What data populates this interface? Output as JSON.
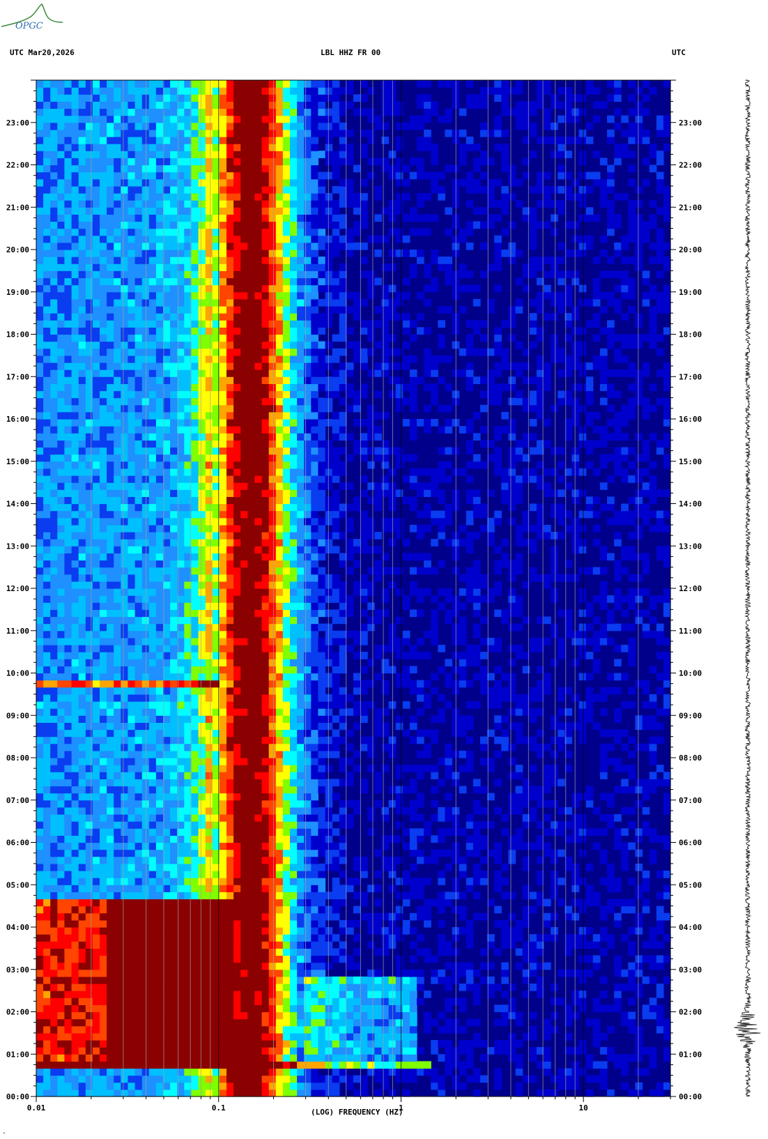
{
  "header": {
    "left": "UTC  Mar20,2026",
    "center": "LBL HHZ FR 00",
    "right": "UTC"
  },
  "logo": {
    "text": "OPGC"
  },
  "corner_mark": "\"",
  "chart_data": {
    "type": "heatmap",
    "title": "LBL HHZ FR 00",
    "date": "Mar20,2026",
    "xlabel": "(LOG) FREQUENCY (HZ)",
    "ylabel": "UTC",
    "x_scale": "log",
    "xlim": [
      0.01,
      30
    ],
    "x_ticks": [
      {
        "value": 0.01,
        "label": "0.01"
      },
      {
        "value": 0.1,
        "label": "0.1"
      },
      {
        "value": 1,
        "label": "1"
      },
      {
        "value": 10,
        "label": "10"
      }
    ],
    "ylim": [
      0,
      24
    ],
    "y_ticks": [
      "00:00",
      "01:00",
      "02:00",
      "03:00",
      "04:00",
      "05:00",
      "06:00",
      "07:00",
      "08:00",
      "09:00",
      "10:00",
      "11:00",
      "12:00",
      "13:00",
      "14:00",
      "15:00",
      "16:00",
      "17:00",
      "18:00",
      "19:00",
      "20:00",
      "21:00",
      "22:00",
      "23:00"
    ],
    "grid": true,
    "colormap": [
      "#00008b",
      "#0000cd",
      "#0a3cf0",
      "#1e90ff",
      "#00bfff",
      "#00ffff",
      "#7fff00",
      "#ffff00",
      "#ffa500",
      "#ff4500",
      "#ff0000",
      "#8b0000"
    ],
    "microseism_peak_hz": 0.15,
    "events": [
      {
        "time_h": 0.75,
        "description": "band",
        "f_max_hz": 1.5
      },
      {
        "time_h": 1.3,
        "f_max_hz": 0.6
      },
      {
        "time_h": 2.8,
        "f_max_hz": 2.5
      },
      {
        "time_h": 9.75,
        "f_max_hz": 0.1
      },
      {
        "time_h": 9.3,
        "f_max_hz": 0.1
      }
    ],
    "low_freq_noise_window_h": [
      0.6,
      4.7
    ]
  },
  "seismogram": {
    "event_window_h": [
      0.8,
      2.9
    ],
    "peak_time_h": 1.6
  }
}
